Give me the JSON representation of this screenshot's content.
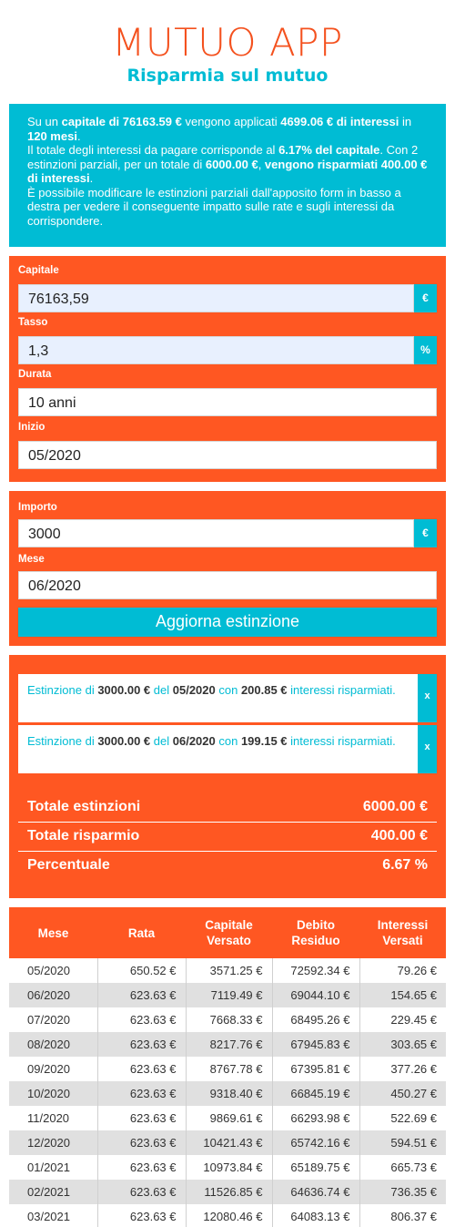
{
  "app": {
    "title": "MUTUO APP",
    "subtitle": "Risparmia sul mutuo"
  },
  "info": {
    "l1a": "Su un ",
    "l1b": "capitale di 76163.59 €",
    "l1c": " vengono applicati ",
    "l1d": "4699.06 € di interessi",
    "l1e": " in ",
    "l1f": "120 mesi",
    "l1g": ".",
    "l2a": "Il totale degli interessi da pagare corrisponde al ",
    "l2b": "6.17% del capitale",
    "l2c": ". Con 2 estinzioni parziali, per un totale di ",
    "l2d": "6000.00 €",
    "l2e": ", ",
    "l2f": "vengono risparmiati 400.00 € di interessi",
    "l2g": ".",
    "l3": "È possibile modificare le estinzioni parziali dall'apposito form in basso a destra per vedere il conseguente impatto sulle rate e sugli interessi da corrispondere."
  },
  "loan_form": {
    "capitale_label": "Capitale",
    "capitale_value": "76163,59",
    "capitale_unit": "€",
    "tasso_label": "Tasso",
    "tasso_value": "1,3",
    "tasso_unit": "%",
    "durata_label": "Durata",
    "durata_value": "10 anni",
    "inizio_label": "Inizio",
    "inizio_value": "05/2020"
  },
  "extinction_form": {
    "importo_label": "Importo",
    "importo_value": "3000",
    "importo_unit": "€",
    "mese_label": "Mese",
    "mese_value": "06/2020",
    "button": "Aggiorna estinzione"
  },
  "extinctions": [
    {
      "p1": "Estinzione di ",
      "amount": "3000.00 €",
      "p2": " del ",
      "date": "05/2020",
      "p3": " con ",
      "saved": "200.85 €",
      "p4": " interessi risparmiati.",
      "remove": "x"
    },
    {
      "p1": "Estinzione di ",
      "amount": "3000.00 €",
      "p2": " del ",
      "date": "06/2020",
      "p3": " con ",
      "saved": "199.15 €",
      "p4": " interessi risparmiati.",
      "remove": "x"
    }
  ],
  "totals": {
    "estinzioni_label": "Totale estinzioni",
    "estinzioni_value": "6000.00 €",
    "risparmio_label": "Totale risparmio",
    "risparmio_value": "400.00 €",
    "percentuale_label": "Percentuale",
    "percentuale_value": "6.67 %"
  },
  "table": {
    "headers": [
      "Mese",
      "Rata",
      "Capitale Versato",
      "Debito Residuo",
      "Interessi Versati"
    ],
    "rows": [
      [
        "05/2020",
        "650.52 €",
        "3571.25 €",
        "72592.34 €",
        "79.26 €"
      ],
      [
        "06/2020",
        "623.63 €",
        "7119.49 €",
        "69044.10 €",
        "154.65 €"
      ],
      [
        "07/2020",
        "623.63 €",
        "7668.33 €",
        "68495.26 €",
        "229.45 €"
      ],
      [
        "08/2020",
        "623.63 €",
        "8217.76 €",
        "67945.83 €",
        "303.65 €"
      ],
      [
        "09/2020",
        "623.63 €",
        "8767.78 €",
        "67395.81 €",
        "377.26 €"
      ],
      [
        "10/2020",
        "623.63 €",
        "9318.40 €",
        "66845.19 €",
        "450.27 €"
      ],
      [
        "11/2020",
        "623.63 €",
        "9869.61 €",
        "66293.98 €",
        "522.69 €"
      ],
      [
        "12/2020",
        "623.63 €",
        "10421.43 €",
        "65742.16 €",
        "594.51 €"
      ],
      [
        "01/2021",
        "623.63 €",
        "10973.84 €",
        "65189.75 €",
        "665.73 €"
      ],
      [
        "02/2021",
        "623.63 €",
        "11526.85 €",
        "64636.74 €",
        "736.35 €"
      ],
      [
        "03/2021",
        "623.63 €",
        "12080.46 €",
        "64083.13 €",
        "806.37 €"
      ]
    ]
  }
}
